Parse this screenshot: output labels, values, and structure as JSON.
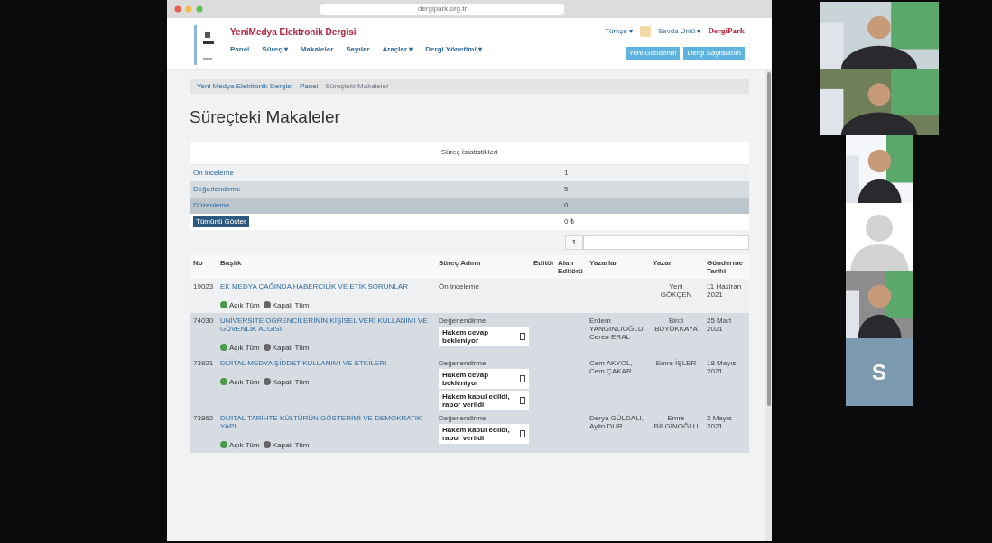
{
  "browser": {
    "address": "dergipark.org.tr"
  },
  "site": {
    "title": "YeniMedya Elektronik Dergisi",
    "language": "Türkçe ▾",
    "user": "Sevda Ünlü ▾",
    "badge": "DergiPark",
    "nav": [
      "Panel",
      "Süreç ▾",
      "Makaleler",
      "Sayılar",
      "Araçlar ▾",
      "Dergi Yönetimi ▾"
    ],
    "actions": [
      "Yeni Gönderim",
      "Dergi Sayfalarım"
    ]
  },
  "breadcrumb": [
    "Yeni Medya Elektronik Dergisi",
    "Panel",
    "Süreçteki Makaleler"
  ],
  "page_title": "Süreçteki Makaleler",
  "stats": {
    "heading": "Süreç İstatistikleri",
    "rows": [
      {
        "kind": "link",
        "label": "Ön inceleme",
        "value": "1"
      },
      {
        "kind": "link",
        "label": "Değerlendirme",
        "value": "5"
      },
      {
        "kind": "link",
        "label": "Düzenleme",
        "value": "0"
      },
      {
        "kind": "button",
        "label": "Tümünü Göster",
        "value": "0 ₺"
      }
    ]
  },
  "pager": {
    "page": "1"
  },
  "table": {
    "columns": [
      "No",
      "Başlık",
      "Süreç Adımı",
      "Editör",
      "Alan Editörü",
      "Yazarlar",
      "Yazar",
      "Gönderme Tarihi"
    ],
    "rows": [
      {
        "selected": false,
        "no": "19023",
        "title": "EK MEDYA ÇAĞINDA HABERCİLİK VE ETİK SORUNLAR",
        "step": "Ön inceleme",
        "reviews": [],
        "authors": "",
        "author": "Yeni GÖKÇEN",
        "date": "11 Haziran 2021",
        "links": [
          "Açık Tüm",
          "Kapalı Tüm"
        ]
      },
      {
        "selected": true,
        "no": "74030",
        "title": "ÜNİVERSİTE ÖĞRENCİLERİNİN KİŞİSEL VERİ KULLANIMI VE GÜVENLİK ALGISI",
        "step": "Değerlendirme",
        "reviews": [
          "Hakem cevap bekleniyor"
        ],
        "authors": "Erdem YANGINLIOĞLU Ceren ERAL",
        "author": "Birol BÜYÜKKAYA",
        "date": "25 Mart 2021",
        "links": [
          "Açık Tüm",
          "Kapalı Tüm"
        ]
      },
      {
        "selected": true,
        "no": "73921",
        "title": "DİJİTAL MEDYA ŞİDDET KULLANIMI VE ETKİLERİ",
        "step": "Değerlendirme",
        "reviews": [
          "Hakem cevap bekleniyor",
          "Hakem kabul edildi, rapor verildi"
        ],
        "authors": "Cem AKYOL, Cem ÇAKAR",
        "author": "Emre İŞLER",
        "date": "18 Mayıs 2021",
        "links": [
          "Açık Tüm",
          "Kapalı Tüm"
        ]
      },
      {
        "selected": true,
        "no": "73862",
        "title": "DİJİTAL TARİHTE KÜLTÜRÜN GÖSTERİMİ VE DEMOKRATİK YAPI",
        "step": "Değerlendirme",
        "reviews": [
          "Hakem kabul edildi, rapor verildi"
        ],
        "authors": "Derya GÜLDALI, Aylin DUR",
        "author": "Emre BİLGİNOĞLU",
        "date": "2 Mayıs 2021",
        "links": [
          "Açık Tüm",
          "Kapalı Tüm"
        ]
      }
    ]
  },
  "participants": [
    {
      "kind": "video"
    },
    {
      "kind": "video"
    },
    {
      "kind": "video"
    },
    {
      "kind": "avatar"
    },
    {
      "kind": "video"
    },
    {
      "kind": "initial",
      "initial": "S",
      "color": "#7d9bb0"
    }
  ]
}
